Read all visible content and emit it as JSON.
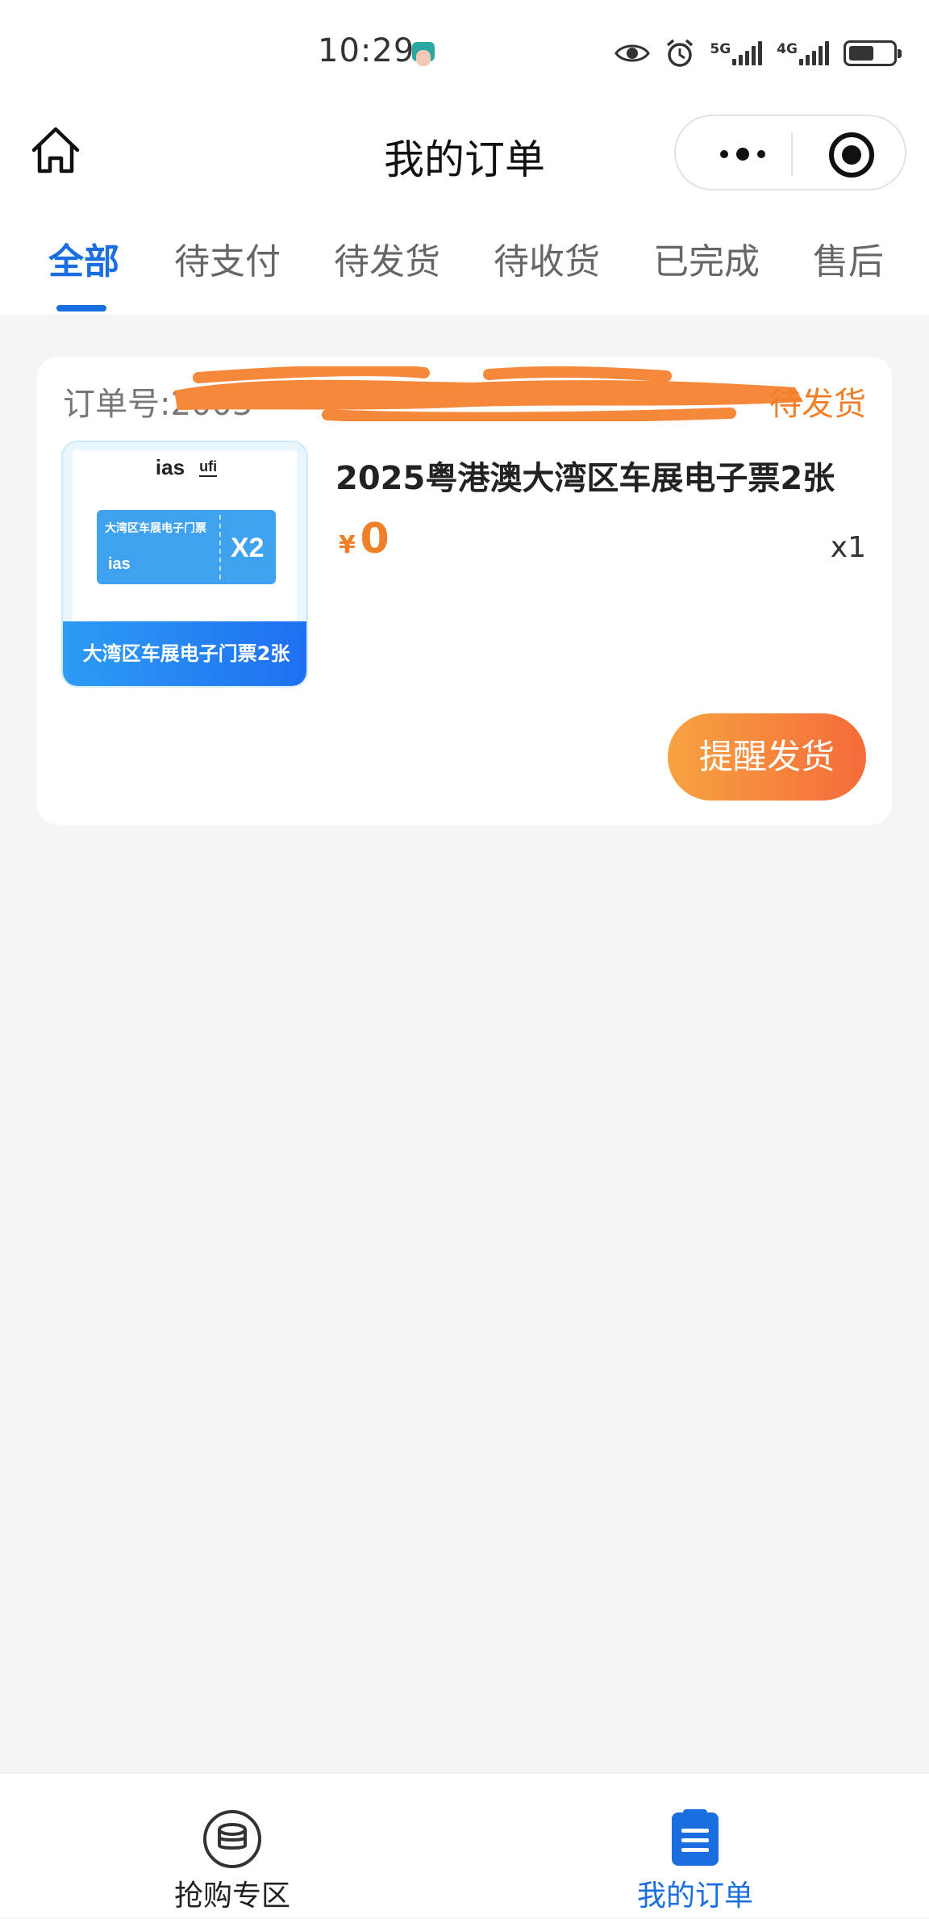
{
  "status_bar": {
    "time": "10:29",
    "network_1": "5G",
    "network_2": "4G"
  },
  "nav": {
    "title": "我的订单"
  },
  "tabs": [
    {
      "label": "全部",
      "active": true
    },
    {
      "label": "待支付",
      "active": false
    },
    {
      "label": "待发货",
      "active": false
    },
    {
      "label": "待收货",
      "active": false
    },
    {
      "label": "已完成",
      "active": false
    },
    {
      "label": "售后",
      "active": false
    }
  ],
  "order": {
    "order_no_label": "订单号:2003",
    "status": "待发货",
    "product_title": "2025粤港澳大湾区车展电子票2张",
    "currency_symbol": "¥",
    "price": "0",
    "quantity": "x1",
    "remind_button": "提醒发货",
    "image": {
      "logo_text": "ias",
      "logo_secondary": "ufi",
      "ticket_title": "大湾区车展电子门票",
      "ticket_qty": "X2",
      "banner": "大湾区车展电子门票2张"
    }
  },
  "bottom_bar": {
    "items": [
      {
        "label": "抢购专区",
        "icon": "coin-stack-icon",
        "active": false
      },
      {
        "label": "我的订单",
        "icon": "order-list-icon",
        "active": true
      }
    ]
  },
  "colors": {
    "accent": "#1a6ee0",
    "status_orange": "#f07f2a",
    "button_gradient_start": "#f6a341",
    "button_gradient_end": "#f56b3a",
    "background": "#f5f5f5"
  }
}
